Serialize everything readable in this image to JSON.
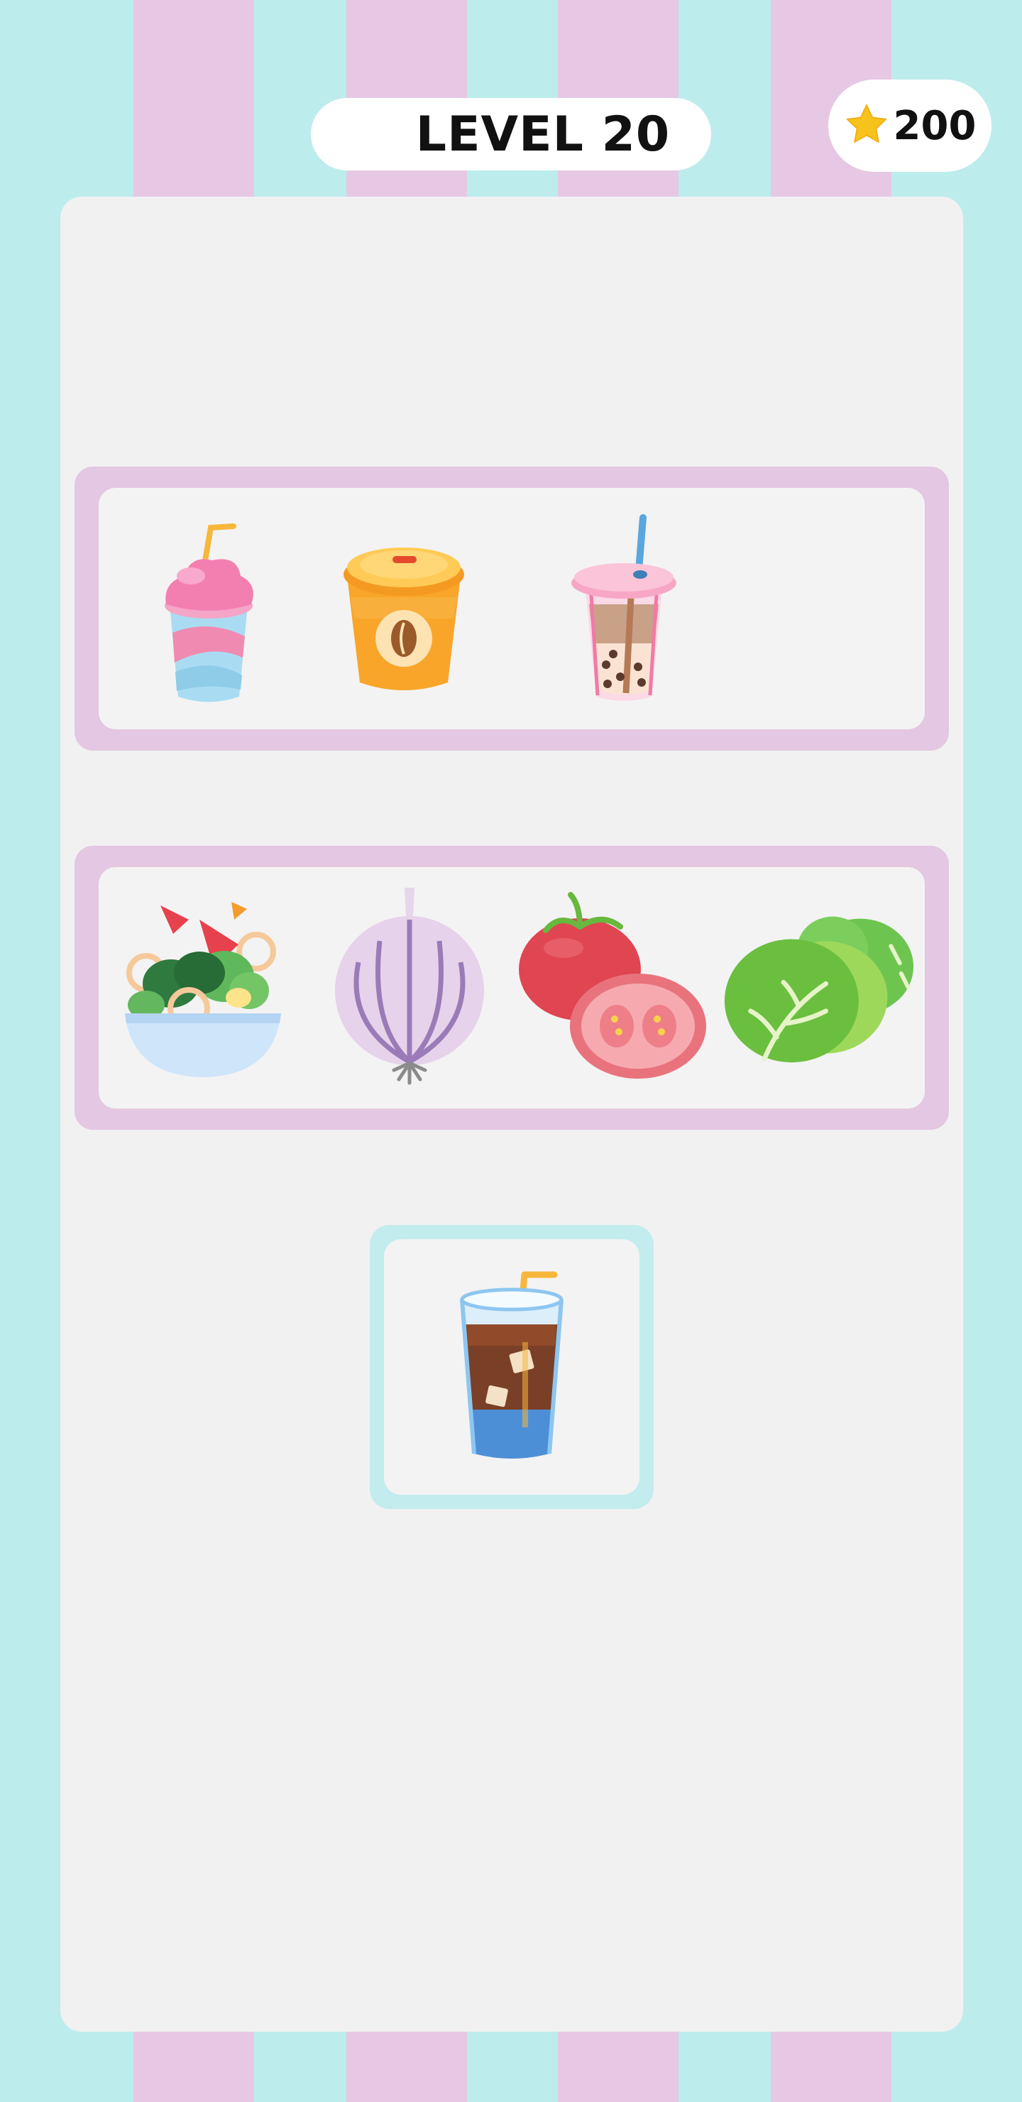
{
  "header": {
    "level_label": "LEVEL 20",
    "score": "200",
    "score_icon": "star-icon"
  },
  "shelves": [
    {
      "items": [
        {
          "name": "milkshake",
          "icon": "milkshake-icon"
        },
        {
          "name": "coffee-cup",
          "icon": "coffee-cup-icon"
        },
        {
          "name": "bubble-tea",
          "icon": "bubble-tea-icon"
        }
      ]
    },
    {
      "items": [
        {
          "name": "salad",
          "icon": "salad-bowl-icon"
        },
        {
          "name": "onion",
          "icon": "onion-icon"
        },
        {
          "name": "tomato",
          "icon": "tomato-icon"
        },
        {
          "name": "lettuce",
          "icon": "lettuce-icon"
        }
      ]
    }
  ],
  "tray": {
    "item": {
      "name": "iced-cola",
      "icon": "iced-cola-icon"
    }
  },
  "colors": {
    "background": "#bdeced",
    "stripe": "#e6c8e4",
    "shelf_frame": "#e4c7e2",
    "tray_frame": "#c2ecee",
    "star": "#f7c21b"
  }
}
